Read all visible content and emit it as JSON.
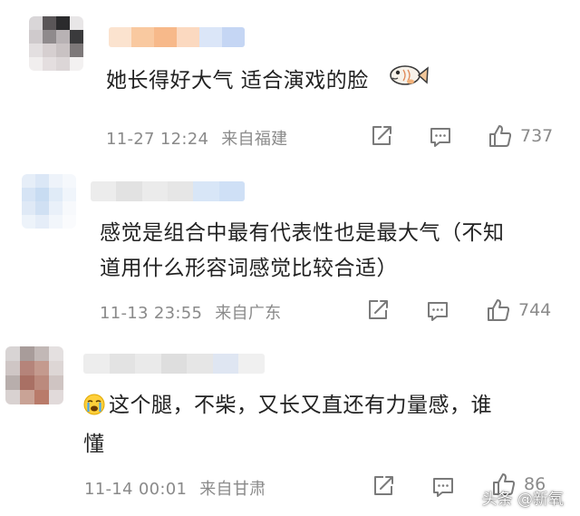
{
  "comments": [
    {
      "text": "她长得好大气 适合演戏的脸",
      "emoji": "fish-emoji",
      "time": "11-27 12:24",
      "location": "来自福建",
      "likes": "737"
    },
    {
      "text_line1": "感觉是组合中最有代表性也是最大气（不知",
      "text_line2": "道用什么形容词感觉比较合适）",
      "time": "11-13 23:55",
      "location": "来自广东",
      "likes": "744"
    },
    {
      "emoji": "crying-emoji",
      "text_line1": "这个腿，不柴，又长又直还有力量感，谁",
      "text_line2": "懂",
      "time": "11-14 00:01",
      "location": "来自甘肃",
      "likes": "86"
    }
  ],
  "icons": [
    "share-icon",
    "comment-icon",
    "like-icon"
  ],
  "watermark": "头条 @新氧"
}
